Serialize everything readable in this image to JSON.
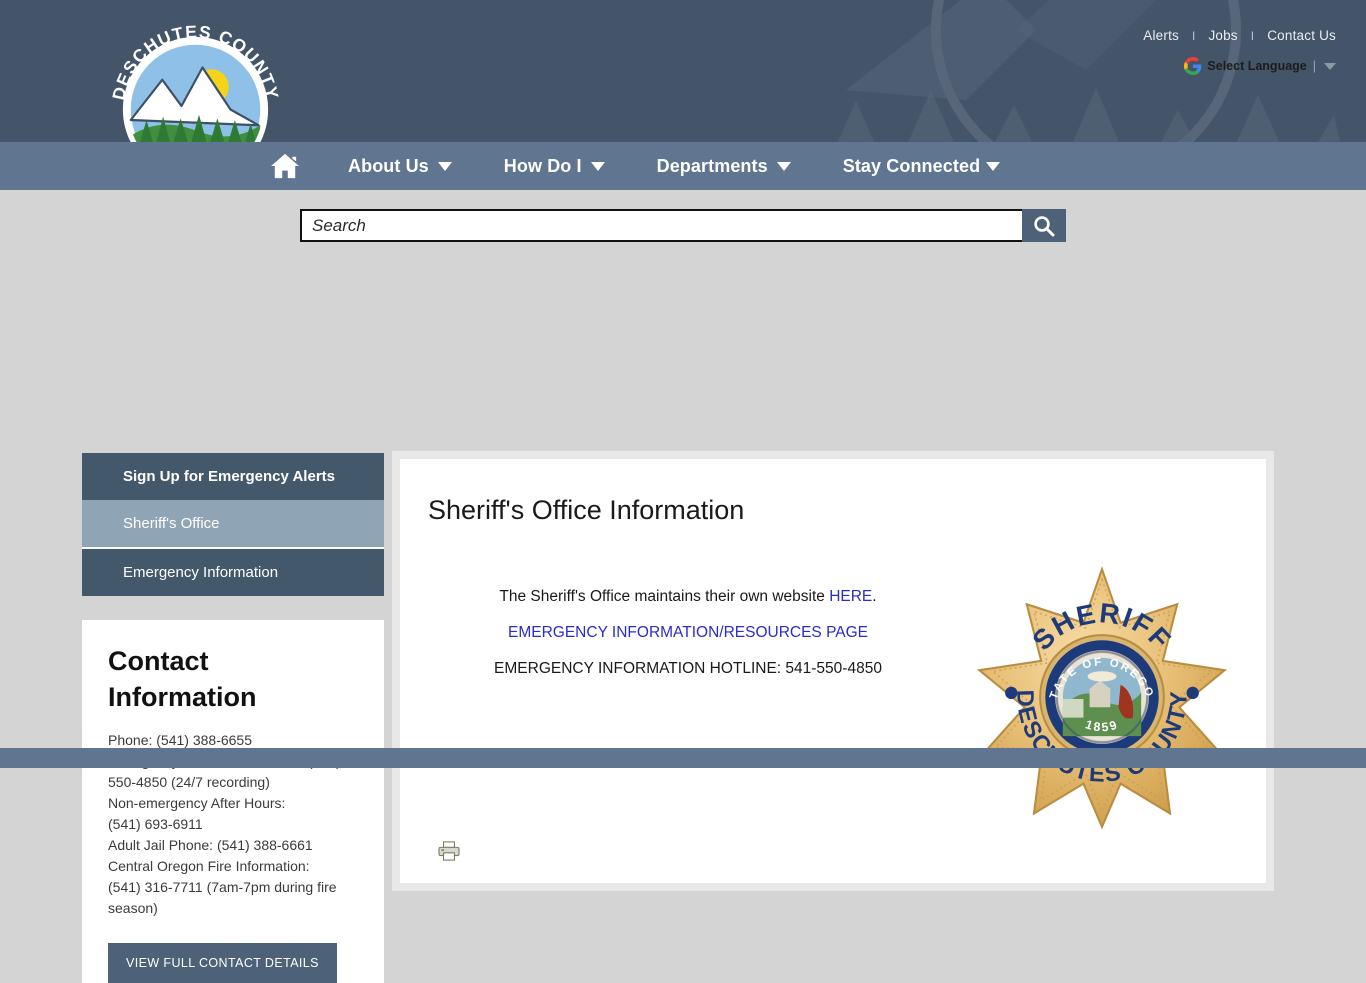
{
  "header": {
    "logo_text_top": "DESCHUTES COUNTY",
    "logo_alt": "deschutes-county-seal",
    "top_links": [
      {
        "label": "Alerts"
      },
      {
        "label": "Jobs"
      },
      {
        "label": "Contact Us"
      }
    ],
    "separator": "I",
    "translate": {
      "icon": "google-g-icon",
      "label": "Select Language",
      "pipe": "|",
      "caret": "chevron-down-icon"
    }
  },
  "nav": {
    "home_icon": "home-icon",
    "items": [
      {
        "label": "About Us",
        "caret": true
      },
      {
        "label": "How Do I",
        "caret": true
      },
      {
        "label": "Departments",
        "caret": true
      },
      {
        "label": "Stay Connected",
        "caret": true
      }
    ]
  },
  "search": {
    "placeholder": "Search",
    "value": "",
    "button_icon": "search-icon"
  },
  "sidebar": {
    "items": [
      {
        "label": "Sign Up for Emergency Alerts",
        "active": false,
        "bold": true
      },
      {
        "label": "Sheriff's Office",
        "active": true,
        "bold": false
      },
      {
        "label": "Emergency Information",
        "active": false,
        "bold": false
      }
    ],
    "contact": {
      "title": "Contact Information",
      "details": "Phone: (541) 388-6655\nEmergency Information Hotline: (541) 550-4850 (24/7 recording)\nNon-emergency After Hours:\n(541) 693-6911\nAdult Jail Phone: (541) 388-6661\nCentral Oregon Fire Information:\n(541) 316-7711 (7am-7pm during fire season)",
      "button_label": "VIEW FULL CONTACT DETAILS"
    }
  },
  "main": {
    "title": "Sheriff's Office Information",
    "line1_prefix": "The Sheriff's Office maintains their own website ",
    "line1_link": "HERE",
    "line1_suffix": ".",
    "line2_link": "EMERGENCY INFORMATION/RESOURCES PAGE",
    "line3": "EMERGENCY INFORMATION HOTLINE: 541-550-4850",
    "badge": {
      "alt": "sheriff-badge",
      "top_text": "SHERIFF",
      "bottom_text": "DESCHUTES COUNTY",
      "ring_text": "STATE OF OREGON",
      "year": "1859"
    },
    "print_icon": "print-icon"
  },
  "colors": {
    "header_bg": "#44556a",
    "nav_bg": "#607590",
    "page_bg": "#d4d4d4",
    "sidebar_bg": "#44586c",
    "sidebar_active": "#8fa4b5",
    "accent_button": "#4d6278",
    "link": "#2b2bc9",
    "badge_gold": "#e3b45c"
  }
}
